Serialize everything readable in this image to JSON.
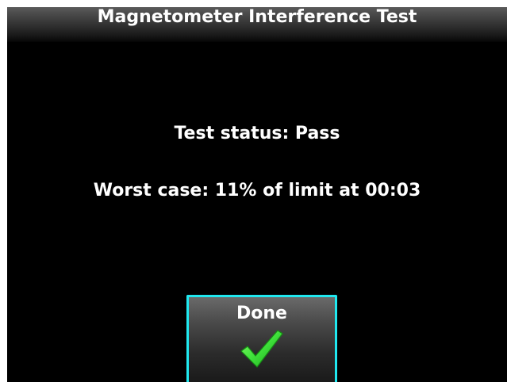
{
  "header": {
    "title": "Magnetometer Interference Test"
  },
  "main": {
    "status_text": "Test status: Pass",
    "worst_case_text": "Worst case: 11% of limit at 00:03"
  },
  "done_button": {
    "label": "Done",
    "icon": "checkmark-icon"
  },
  "colors": {
    "background": "#000000",
    "text": "#ffffff",
    "button_border": "#20e8f0",
    "checkmark": "#3ee03a"
  }
}
